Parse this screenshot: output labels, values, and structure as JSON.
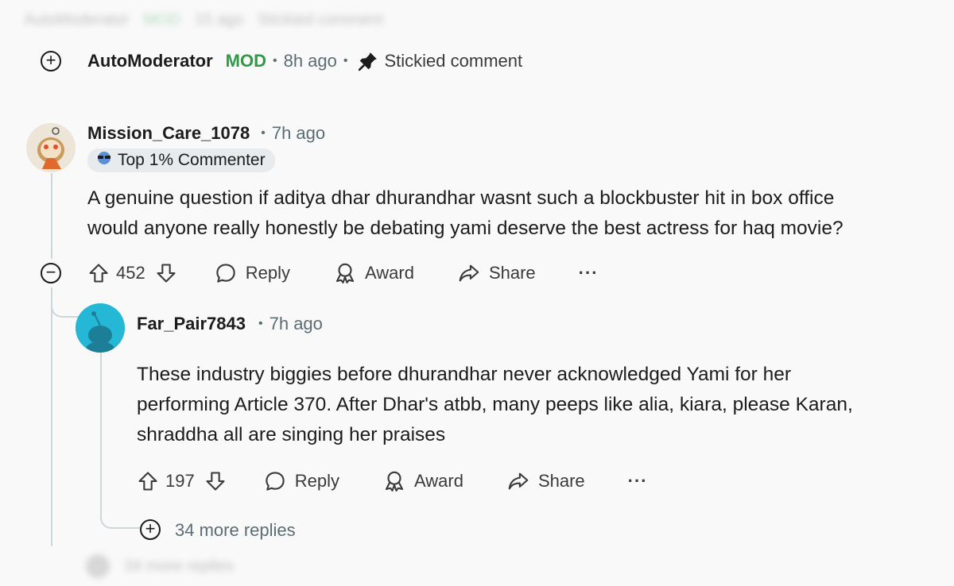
{
  "blurred_top": {
    "user": "AutoModerator",
    "mod": "MOD",
    "time": "15 ago",
    "note": "Stickied comment"
  },
  "automod": {
    "username": "AutoModerator",
    "mod_label": "MOD",
    "separator": "•",
    "time": "8h ago",
    "stickied": "Stickied comment"
  },
  "comment1": {
    "username": "Mission_Care_1078",
    "separator": "•",
    "time": "7h ago",
    "badge": "Top 1% Commenter",
    "text_line1": "A genuine question if aditya dhar dhurandhar wasnt such a blockbuster  hit in box office",
    "text_line2": "would anyone really honestly be debating yami deserve the best actress for haq movie?",
    "votes": "452",
    "reply": "Reply",
    "award": "Award",
    "share": "Share",
    "more": "···"
  },
  "comment2": {
    "username": "Far_Pair7843",
    "separator": "•",
    "time": "7h ago",
    "text_line1": "These industry biggies before dhurandhar never acknowledged Yami for her",
    "text_line2": "performing Article 370. After Dhar's atbb, many peeps like alia, kiara, please Karan,",
    "text_line3": "shraddha all are singing her praises",
    "votes": "197",
    "reply": "Reply",
    "award": "Award",
    "share": "Share",
    "more": "···",
    "more_replies": "34 more replies"
  },
  "blurred_bottom": {
    "text": "34 more replies"
  },
  "colors": {
    "mod_green": "#2f9a47",
    "meta_gray": "#5c6c74",
    "thread_line": "#cfd6da",
    "badge_bg": "#e8ebed"
  }
}
